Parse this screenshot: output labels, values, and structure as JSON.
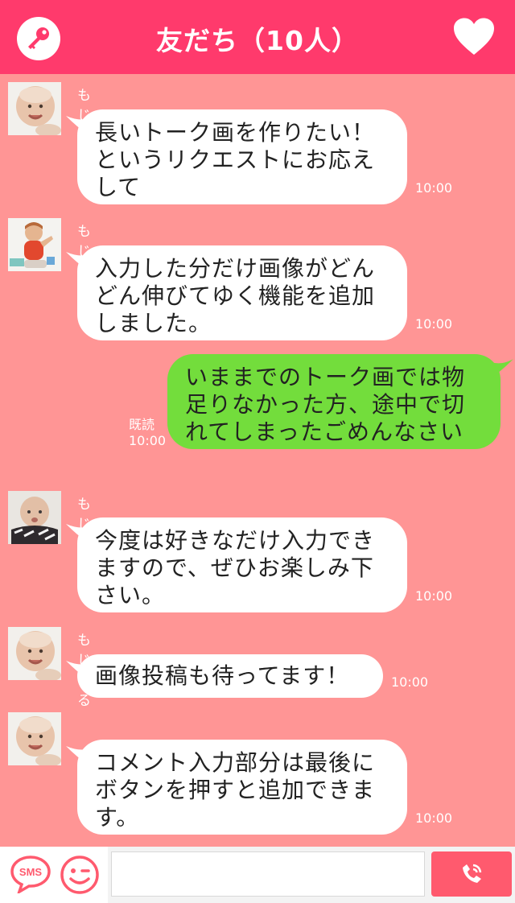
{
  "header": {
    "title": "友だち（10人）",
    "bg_color": "#ff3a6c",
    "left_icon": "key-icon",
    "right_icon": "heart-icon"
  },
  "messages": [
    {
      "sender": "もじまる",
      "avatar": "baby-photo-1",
      "lines": [
        "長いトーク画を作りたい！",
        "というリクエストにお応え",
        "して"
      ],
      "time": "10:00"
    },
    {
      "sender": "もじまる2",
      "avatar": "baby-photo-2",
      "lines": [
        "入力した分だけ画像がどん",
        "どん伸びてゆく機能を追加",
        "しました。"
      ],
      "time": "10:00"
    },
    {
      "mine": true,
      "lines": [
        "いままでのトーク画では物",
        "足りなかった方、途中で切",
        "れてしまったごめんなさい"
      ],
      "read_label": "既読",
      "time": "10:00"
    },
    {
      "sender": "もじまる",
      "avatar": "baby-photo-3",
      "lines": [
        "今度は好きなだけ入力でき",
        "ますので、ぜひお楽しみ下",
        "さい。"
      ],
      "time": "10:00"
    },
    {
      "sender": "もじまる",
      "avatar": "baby-photo-1",
      "lines": [
        "画像投稿も待ってます！"
      ],
      "time": "10:00"
    },
    {
      "avatar": "baby-photo-1",
      "lines": [
        "コメント入力部分は最後に",
        "ボタンを押すと追加できま",
        "す。"
      ],
      "time": "10:00"
    }
  ],
  "footer": {
    "sms_label": "SMS",
    "left_icons": [
      "sms-icon",
      "wink-face-icon"
    ],
    "input_value": "",
    "call_icon": "phone-icon",
    "call_color": "#ff5a6e"
  },
  "colors": {
    "background": "#ff9595",
    "other_bubble": "#ffffff",
    "my_bubble": "#73dd3c"
  }
}
